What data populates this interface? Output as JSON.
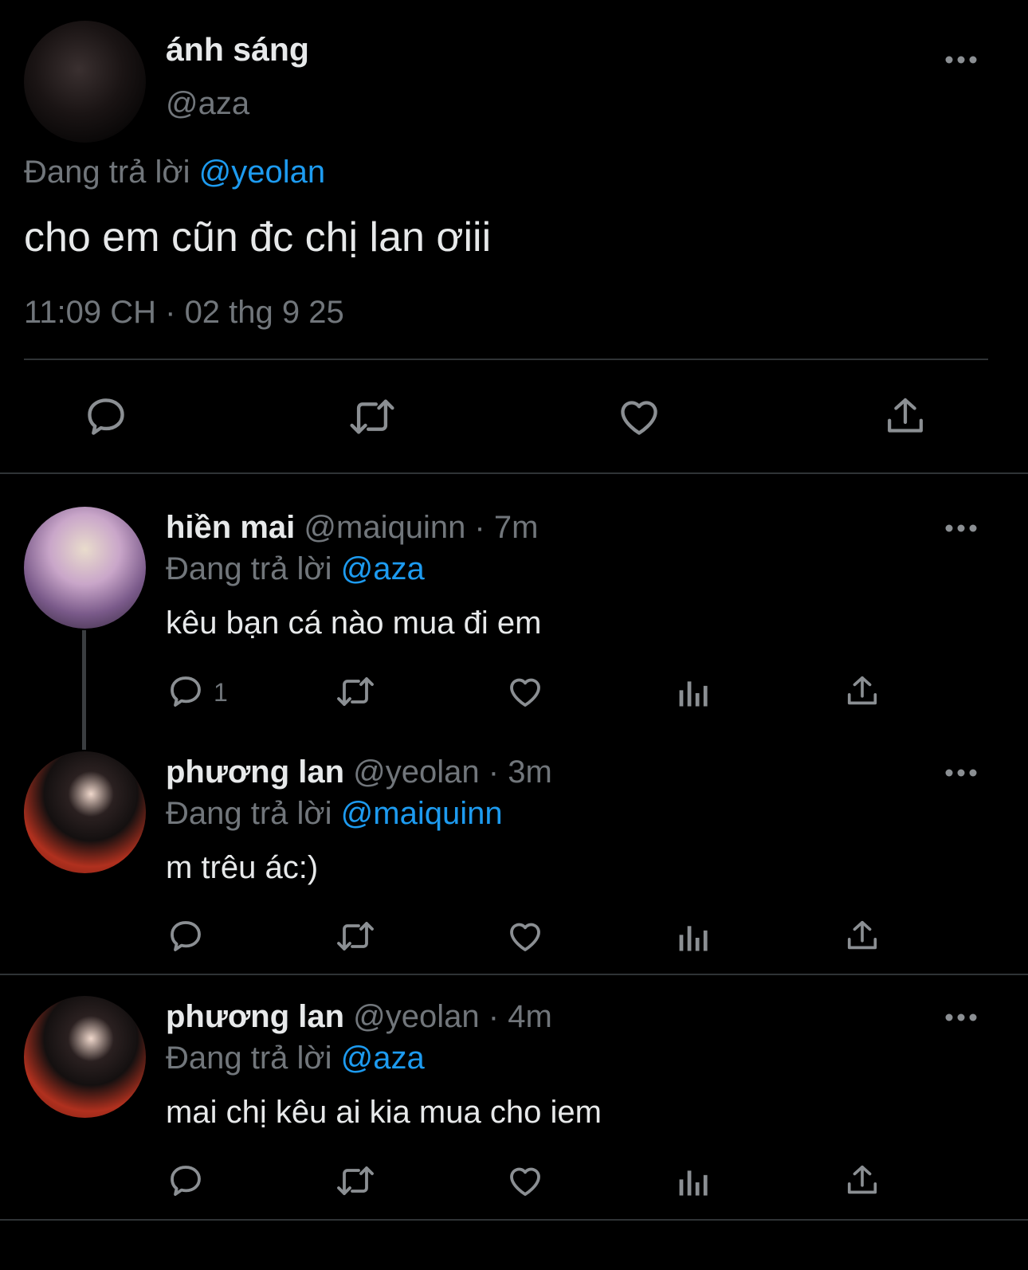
{
  "main_tweet": {
    "display_name": "ánh sáng",
    "handle": "@aza",
    "reply_prefix": "Đang trả lời",
    "reply_to": "@yeolan",
    "text": "cho em cũn đc chị lan ơiii",
    "timestamp": "11:09 CH · 02 thg 9 25"
  },
  "replies": [
    {
      "display_name": "hiền mai",
      "meta": "@maiquinn · 7m",
      "reply_prefix": "Đang trả lời",
      "reply_to": "@aza",
      "text": "kêu bạn cá nào mua đi em",
      "reply_count": "1"
    },
    {
      "display_name": "phương lan",
      "meta": "@yeolan · 3m",
      "reply_prefix": "Đang trả lời",
      "reply_to": "@maiquinn",
      "text": "m trêu ác:)"
    },
    {
      "display_name": "phương lan",
      "meta": "@yeolan · 4m",
      "reply_prefix": "Đang trả lời",
      "reply_to": "@aza",
      "text": "mai chị kêu ai kia mua cho iem"
    }
  ],
  "icons": {
    "reply": "reply-icon",
    "retweet": "retweet-icon",
    "like": "heart-icon",
    "views": "analytics-icon",
    "share": "share-icon",
    "more": "more-icon"
  },
  "colors": {
    "background": "#000000",
    "text": "#e7e9ea",
    "muted": "#71767b",
    "link": "#1d9bf0",
    "divider": "#2f3336"
  }
}
